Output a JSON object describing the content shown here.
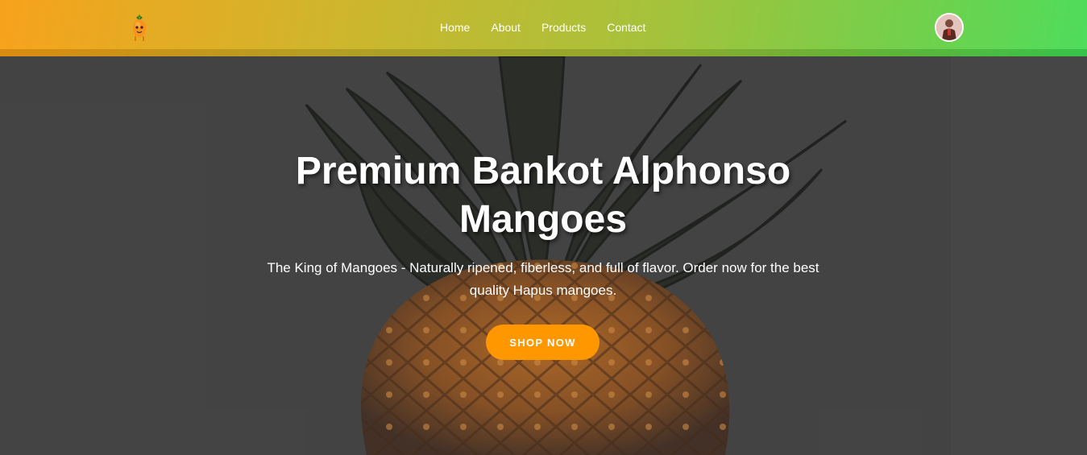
{
  "header": {
    "logo_icon": "mango-mascot-icon",
    "nav": [
      {
        "label": "Home"
      },
      {
        "label": "About"
      },
      {
        "label": "Products"
      },
      {
        "label": "Contact"
      }
    ],
    "avatar_icon": "user-avatar"
  },
  "hero": {
    "title": "Premium Bankot Alphonso Mangoes",
    "subtitle": "The King of Mangoes - Naturally ripened, fiberless, and full of flavor. Order now for the best quality Hapus mangoes.",
    "cta_label": "SHOP NOW",
    "background_icon": "pineapple-image"
  },
  "colors": {
    "header_gradient_start": "#f7a21c",
    "header_gradient_end": "#4fdc5c",
    "cta": "#ff9800",
    "hero_bg": "#474747"
  }
}
